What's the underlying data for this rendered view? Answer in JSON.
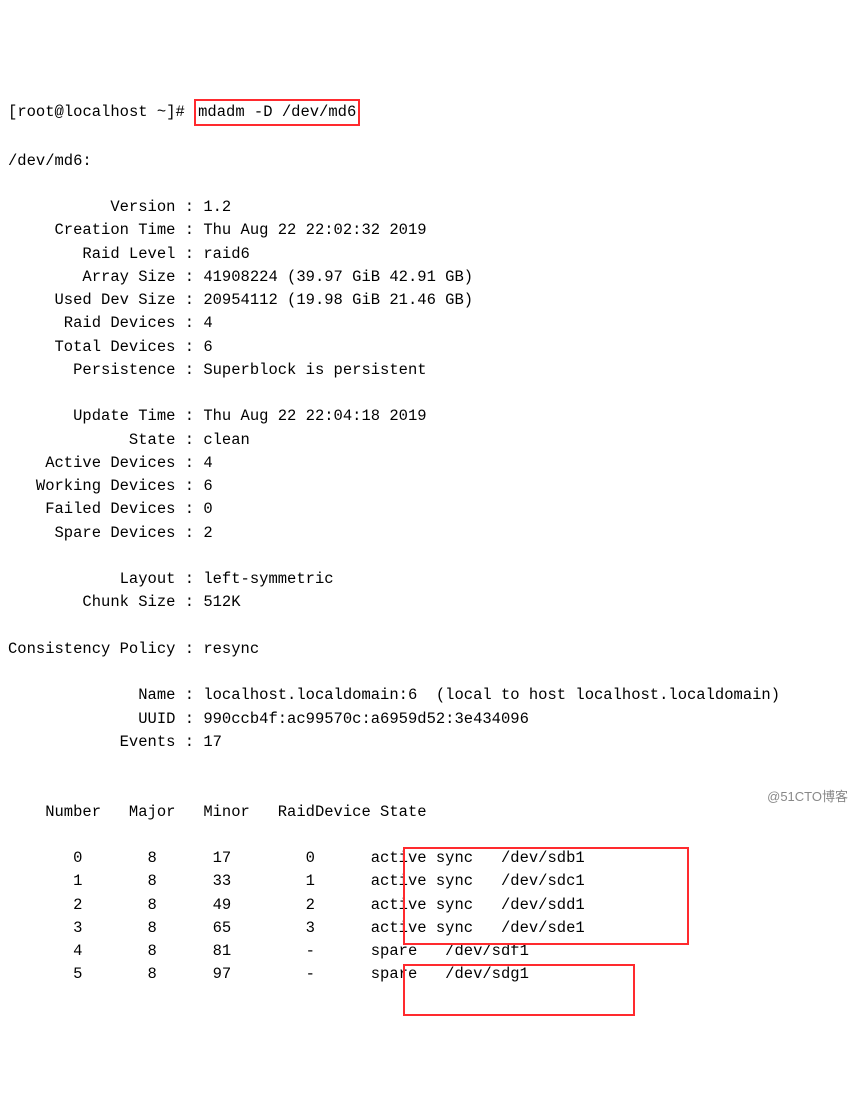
{
  "prompt": {
    "user": "root",
    "host": "localhost",
    "path": "~",
    "symbol": "#",
    "command": "mdadm -D /dev/md6"
  },
  "device_header": "/dev/md6:",
  "fields": {
    "version": {
      "label": "Version",
      "value": "1.2"
    },
    "creation_time": {
      "label": "Creation Time",
      "value": "Thu Aug 22 22:02:32 2019"
    },
    "raid_level": {
      "label": "Raid Level",
      "value": "raid6"
    },
    "array_size": {
      "label": "Array Size",
      "value": "41908224 (39.97 GiB 42.91 GB)"
    },
    "used_dev_size": {
      "label": "Used Dev Size",
      "value": "20954112 (19.98 GiB 21.46 GB)"
    },
    "raid_devices": {
      "label": "Raid Devices",
      "value": "4"
    },
    "total_devices": {
      "label": "Total Devices",
      "value": "6"
    },
    "persistence": {
      "label": "Persistence",
      "value": "Superblock is persistent"
    },
    "update_time": {
      "label": "Update Time",
      "value": "Thu Aug 22 22:04:18 2019"
    },
    "state": {
      "label": "State",
      "value": "clean"
    },
    "active_devices": {
      "label": "Active Devices",
      "value": "4"
    },
    "working_devices": {
      "label": "Working Devices",
      "value": "6"
    },
    "failed_devices": {
      "label": "Failed Devices",
      "value": "0"
    },
    "spare_devices": {
      "label": "Spare Devices",
      "value": "2"
    },
    "layout": {
      "label": "Layout",
      "value": "left-symmetric"
    },
    "chunk_size": {
      "label": "Chunk Size",
      "value": "512K"
    },
    "consistency_policy": {
      "label": "Consistency Policy",
      "value": "resync"
    },
    "name": {
      "label": "Name",
      "value": "localhost.localdomain:6  (local to host localhost.localdomain)"
    },
    "uuid": {
      "label": "UUID",
      "value": "990ccb4f:ac99570c:a6959d52:3e434096"
    },
    "events": {
      "label": "Events",
      "value": "17"
    }
  },
  "table_header": {
    "c1": "Number",
    "c2": "Major",
    "c3": "Minor",
    "c4": "RaidDevice",
    "c5": "State"
  },
  "devices": [
    {
      "number": "0",
      "major": "8",
      "minor": "17",
      "raiddevice": "0",
      "state": "active sync",
      "dev": "/dev/sdb1"
    },
    {
      "number": "1",
      "major": "8",
      "minor": "33",
      "raiddevice": "1",
      "state": "active sync",
      "dev": "/dev/sdc1"
    },
    {
      "number": "2",
      "major": "8",
      "minor": "49",
      "raiddevice": "2",
      "state": "active sync",
      "dev": "/dev/sdd1"
    },
    {
      "number": "3",
      "major": "8",
      "minor": "65",
      "raiddevice": "3",
      "state": "active sync",
      "dev": "/dev/sde1"
    }
  ],
  "spares": [
    {
      "number": "4",
      "major": "8",
      "minor": "81",
      "raiddevice": "-",
      "state": "spare",
      "dev": "/dev/sdf1"
    },
    {
      "number": "5",
      "major": "8",
      "minor": "97",
      "raiddevice": "-",
      "state": "spare",
      "dev": "/dev/sdg1"
    }
  ],
  "watermark": "@51CTO博客"
}
